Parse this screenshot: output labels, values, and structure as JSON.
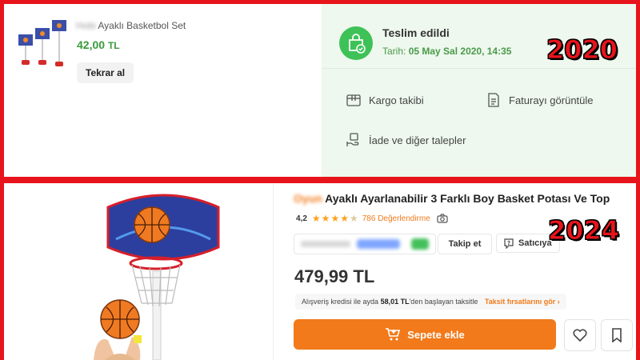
{
  "order_2020": {
    "product_brand": "Hobi",
    "product_name": "Ayaklı Basketbol Set",
    "price_amount": "42,00",
    "price_currency": "TL",
    "reorder_label": "Tekrar al",
    "delivery_status": "Teslim edildi",
    "delivery_date_label": "Tarih:",
    "delivery_date": "05 May Sal 2020, 14:35",
    "actions": {
      "track": "Kargo takibi",
      "invoice": "Faturayı görüntüle",
      "returns": "İade ve diğer talepler"
    },
    "year_stamp": "2020"
  },
  "product_2024": {
    "brand": "Oyun",
    "title": "Ayaklı  Ayarlanabilir 3 Farklı Boy Basket Potası Ve Top",
    "rating": "4,2",
    "stars": 4.2,
    "review_count": "786 Değerlendirme",
    "follow_label": "Takip et",
    "ask_seller_label": "Satıcıya",
    "price": "479,99 TL",
    "installment": {
      "prefix": "Alışveriş kredisi ile ayda",
      "amount": "58,01 TL",
      "suffix": "'den başlayan taksitle",
      "link": "Taksit fırsatlarını gör"
    },
    "add_to_cart_label": "Sepete ekle",
    "year_stamp": "2024"
  },
  "colors": {
    "frame_red": "#e8141b",
    "success_green": "#3ec257",
    "brand_orange": "#f27a1a",
    "star": "#ffa01c"
  }
}
